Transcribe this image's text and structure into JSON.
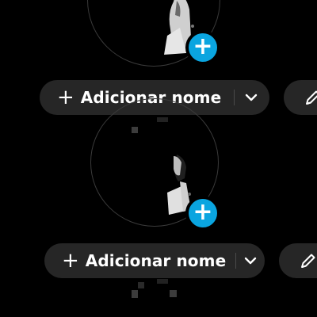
{
  "cards": [
    {
      "add_name_label": "Adicionar nome",
      "plus_glyph": "+",
      "badge_glyph": "+",
      "icons": {
        "add_photo": "plus-circle-icon",
        "dropdown": "chevron-down-icon",
        "edit": "pencil-icon"
      }
    },
    {
      "add_name_label": "Adicionar nome",
      "plus_glyph": "+",
      "badge_glyph": "+",
      "icons": {
        "add_photo": "plus-circle-icon",
        "dropdown": "chevron-down-icon",
        "edit": "pencil-icon"
      }
    }
  ],
  "colors": {
    "background": "#000000",
    "pill": "#262626",
    "accent": "#0aa5e0",
    "text": "#ffffff"
  }
}
